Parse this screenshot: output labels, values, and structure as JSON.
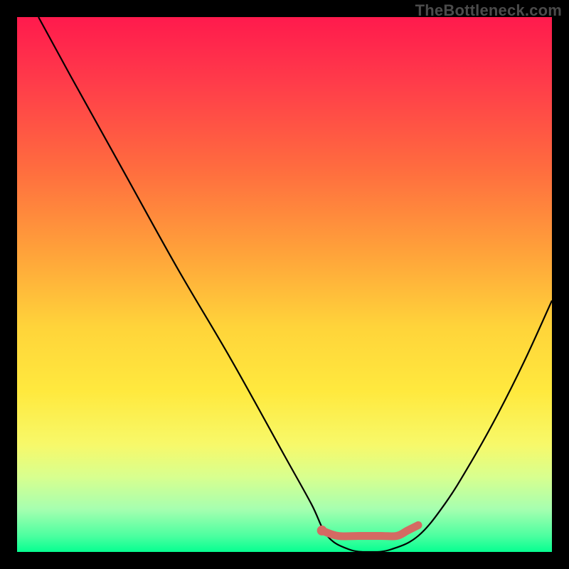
{
  "watermark": "TheBottleneck.com",
  "chart_data": {
    "type": "line",
    "title": "",
    "xlabel": "",
    "ylabel": "",
    "xlim": [
      0,
      100
    ],
    "ylim": [
      0,
      100
    ],
    "grid": false,
    "legend": false,
    "series": [
      {
        "name": "bottleneck-curve",
        "x": [
          4,
          10,
          20,
          30,
          40,
          50,
          55,
          58,
          62,
          66,
          70,
          75,
          80,
          85,
          90,
          95,
          100
        ],
        "y": [
          100,
          89,
          71,
          53,
          36,
          18,
          9,
          3,
          0.5,
          0,
          0.5,
          3,
          9,
          17,
          26,
          36,
          47
        ]
      },
      {
        "name": "highlight-range",
        "x": [
          57,
          60,
          64,
          68,
          71,
          73,
          75
        ],
        "y": [
          4,
          3,
          3,
          3,
          3,
          4,
          5
        ]
      }
    ],
    "colors": {
      "curve": "#000000",
      "highlight": "#d46a63",
      "gradient_top": "#ff1a4d",
      "gradient_bottom": "#06ff91"
    }
  }
}
